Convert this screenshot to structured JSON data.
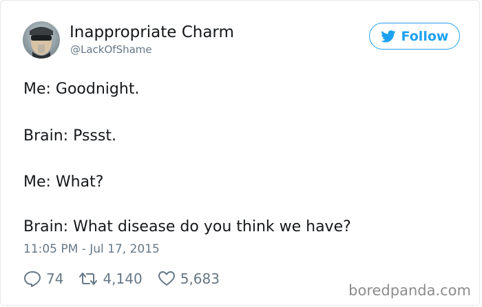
{
  "profile": {
    "display_name": "Inappropriate Charm",
    "handle": "@LackOfShame",
    "avatar_icon": "avatar-photo"
  },
  "follow": {
    "label": "Follow",
    "icon": "twitter-bird-icon",
    "accent_color": "#1da1f2"
  },
  "tweet": {
    "lines": [
      "Me: Goodnight.",
      "Brain: Pssst.",
      "Me: What?",
      "Brain: What disease do you think we have?"
    ],
    "timestamp": "11:05 PM - Jul 17, 2015"
  },
  "actions": {
    "replies": "74",
    "retweets": "4,140",
    "likes": "5,683"
  },
  "watermark": "boredpanda.com"
}
